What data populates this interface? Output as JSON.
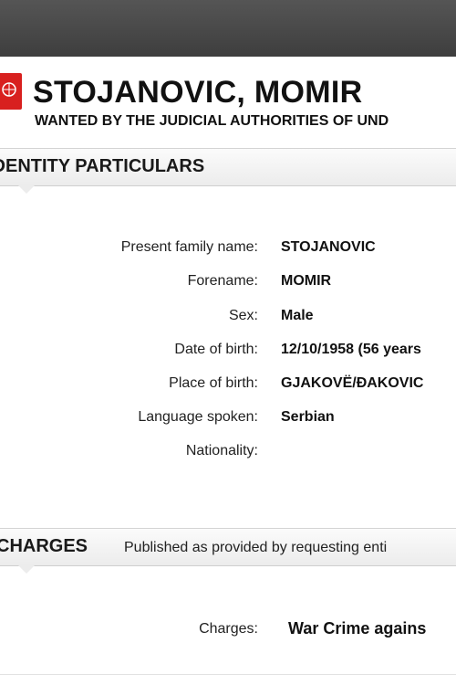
{
  "notice": {
    "name": "STOJANOVIC, MOMIR",
    "subtitle": "WANTED BY THE JUDICIAL AUTHORITIES OF UND"
  },
  "identity": {
    "section_title": "IDENTITY PARTICULARS",
    "fields": [
      {
        "label": "Present family name:",
        "value": "STOJANOVIC"
      },
      {
        "label": "Forename:",
        "value": "MOMIR"
      },
      {
        "label": "Sex:",
        "value": "Male"
      },
      {
        "label": "Date of birth:",
        "value": "12/10/1958 (56 years"
      },
      {
        "label": "Place of birth:",
        "value": "GJAKOVË/ĐAKOVIC"
      },
      {
        "label": "Language spoken:",
        "value": "Serbian"
      },
      {
        "label": "Nationality:",
        "value": ""
      }
    ]
  },
  "charges": {
    "section_title": "CHARGES",
    "note": "Published as provided by requesting enti",
    "label": "Charges:",
    "value": "War Crime agains"
  },
  "colors": {
    "logo_red": "#d8201f",
    "topbar": "#444444"
  }
}
